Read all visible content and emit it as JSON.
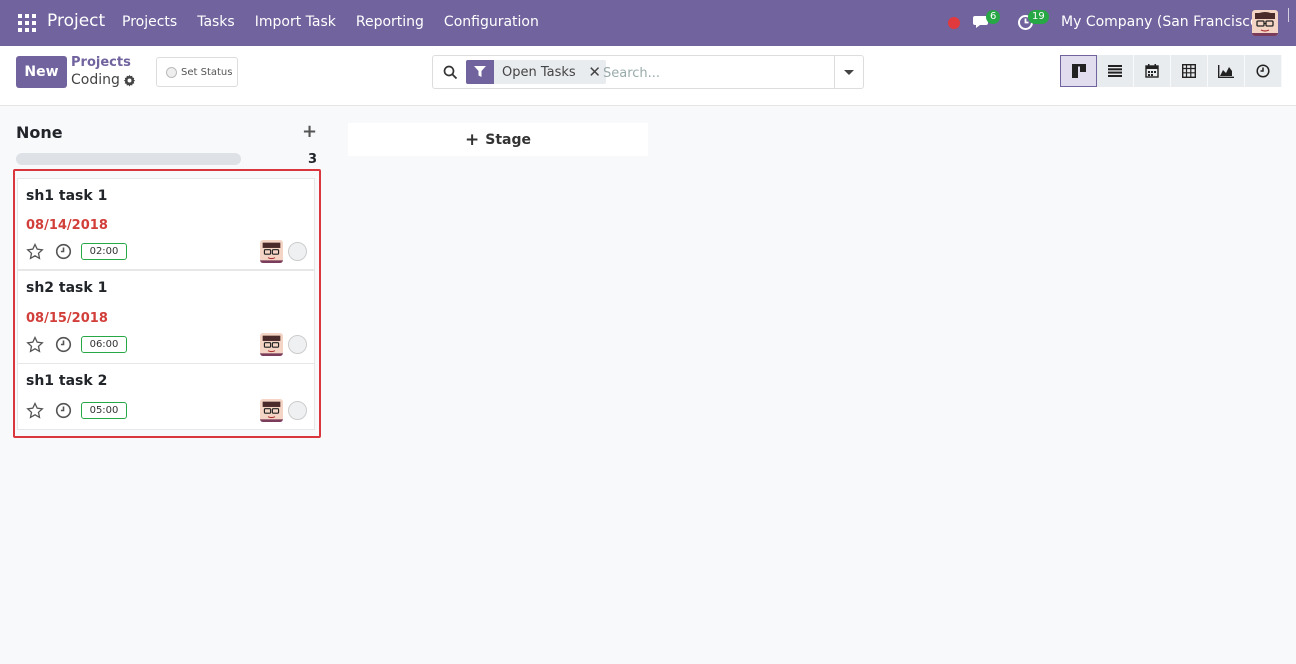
{
  "navbar": {
    "app_name": "Project",
    "menu": [
      "Projects",
      "Tasks",
      "Import Task",
      "Reporting",
      "Configuration"
    ],
    "chat_count": "6",
    "activity_count": "19",
    "company": "My Company (San Francisco)"
  },
  "control_panel": {
    "new_label": "New",
    "breadcrumb_parent": "Projects",
    "breadcrumb_current": "Coding",
    "set_status_label": "Set Status",
    "search": {
      "facet_label": "Open Tasks",
      "placeholder": "Search..."
    },
    "views": [
      "kanban-icon",
      "list-icon",
      "calendar-icon",
      "pivot-icon",
      "graph-icon",
      "activity-icon"
    ]
  },
  "kanban": {
    "column": {
      "title": "None",
      "count": "3",
      "cards": [
        {
          "title": "sh1 task 1",
          "deadline": "08/14/2018",
          "hours": "02:00"
        },
        {
          "title": "sh2 task 1",
          "deadline": "08/15/2018",
          "hours": "06:00"
        },
        {
          "title": "sh1 task 2",
          "deadline": "",
          "hours": "05:00"
        }
      ]
    },
    "add_stage_label": "Stage"
  },
  "colors": {
    "brand": "#71639e",
    "deadline": "#d23f3a",
    "highlight": "#d9363e",
    "badge": "#28a745"
  }
}
